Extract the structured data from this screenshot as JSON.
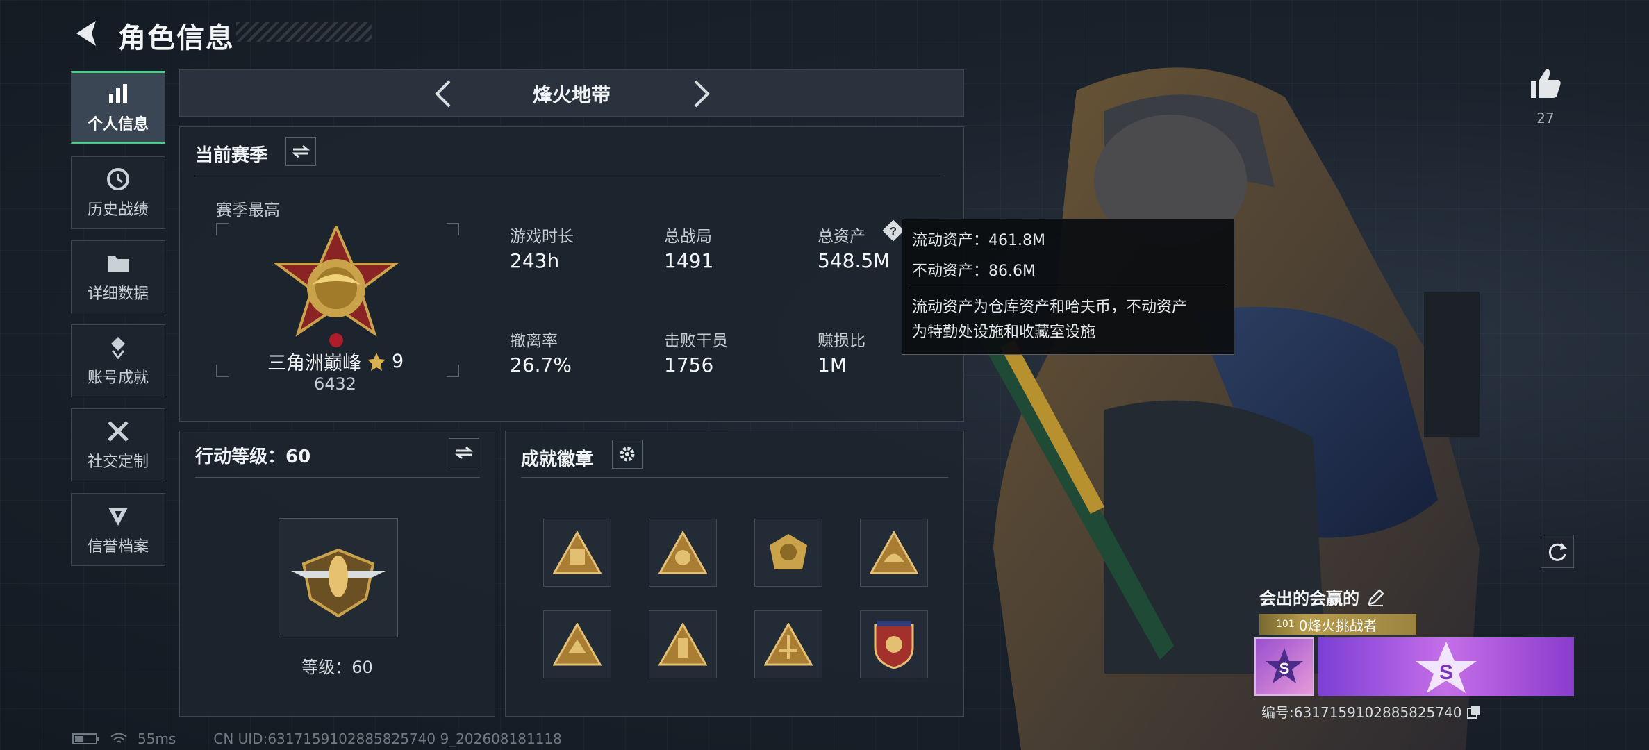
{
  "header": {
    "title": "角色信息",
    "back_icon": "back-arrow-icon"
  },
  "sidebar": {
    "items": [
      {
        "label": "个人信息",
        "icon": "bar-chart-icon",
        "active": true
      },
      {
        "label": "历史战绩",
        "icon": "history-clock-icon"
      },
      {
        "label": "详细数据",
        "icon": "folder-icon"
      },
      {
        "label": "账号成就",
        "icon": "achievement-icon"
      },
      {
        "label": "社交定制",
        "icon": "tools-icon"
      },
      {
        "label": "信誉档案",
        "icon": "credit-shield-icon"
      }
    ]
  },
  "mode_selector": {
    "label": "烽火地带"
  },
  "season": {
    "title": "当前赛季",
    "best_label": "赛季最高",
    "rank_name": "三角洲巅峰",
    "rank_stars": "9",
    "rank_points": "6432",
    "stats": [
      {
        "label": "游戏时长",
        "value": "243h"
      },
      {
        "label": "总战局",
        "value": "1491"
      },
      {
        "label": "总资产",
        "value": "548.5M"
      },
      {
        "label": "撤离率",
        "value": "26.7%"
      },
      {
        "label": "击败干员",
        "value": "1756"
      },
      {
        "label": "赚损比",
        "value": "1M"
      }
    ]
  },
  "tooltip": {
    "liquid": "流动资产：461.8M",
    "fixed": "不动资产：86.6M",
    "note_line1": "流动资产为仓库资产和哈夫币，不动资产",
    "note_line2": "为特勤处设施和收藏室设施"
  },
  "action_level": {
    "title": "行动等级：60",
    "level_text": "等级：60"
  },
  "achievements": {
    "title": "成就徽章",
    "badges": [
      "badge-1",
      "badge-2",
      "badge-3",
      "badge-4",
      "badge-5",
      "badge-6",
      "badge-7",
      "badge-8"
    ]
  },
  "like": {
    "count": "27"
  },
  "profile": {
    "name": "会出的会赢的",
    "tag_level": "101",
    "tag_title": "0烽火挑战者",
    "id_text": "编号:6317159102885825740"
  },
  "status_bar": {
    "ping": "55ms",
    "uid": "CN UID:6317159102885825740 9_202608181118"
  },
  "colors": {
    "accent": "#3fd18a",
    "gold": "#c9a24a",
    "purple": "#a24fd0"
  }
}
